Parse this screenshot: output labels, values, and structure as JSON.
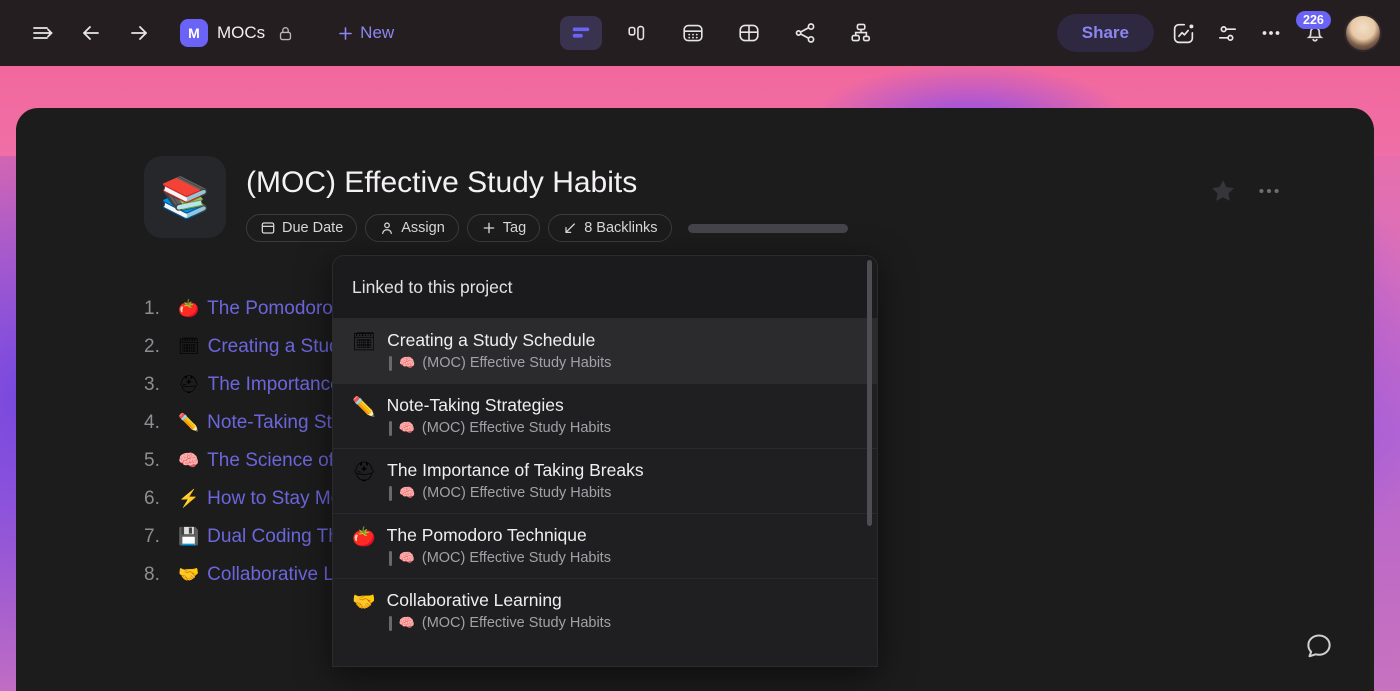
{
  "topbar": {
    "nav": {
      "sidebar_toggle": "sidebar-toggle-icon",
      "back": "back-arrow-icon",
      "forward": "forward-arrow-icon"
    },
    "workspace": {
      "initial": "M",
      "name": "MOCs",
      "lock_icon": "lock-icon"
    },
    "new_label": "New",
    "view_tabs": [
      {
        "name": "list-view",
        "icon": "list-view-icon",
        "active": true
      },
      {
        "name": "board-view",
        "icon": "board-view-icon",
        "active": false
      },
      {
        "name": "calendar-view",
        "icon": "calendar-view-icon",
        "active": false
      },
      {
        "name": "table-view",
        "icon": "table-view-icon",
        "active": false
      },
      {
        "name": "graph-view",
        "icon": "share-graph-icon",
        "active": false
      },
      {
        "name": "hierarchy-view",
        "icon": "hierarchy-icon",
        "active": false
      }
    ],
    "share_label": "Share",
    "activity_icon": "activity-chart-icon",
    "settings_icon": "sliders-icon",
    "more_icon": "ellipsis-icon",
    "notifications": {
      "icon": "bell-icon",
      "count": "226"
    },
    "avatar": "user-avatar"
  },
  "document": {
    "icon_emoji": "📚",
    "title": "(MOC) Effective Study Habits",
    "star_icon": "star-icon",
    "more_icon": "ellipsis-icon",
    "meta_pills": [
      {
        "icon": "calendar-icon",
        "label": "Due Date"
      },
      {
        "icon": "person-icon",
        "label": "Assign"
      },
      {
        "icon": "plus-icon",
        "label": "Tag"
      },
      {
        "icon": "backlink-arrow-icon",
        "label": "8 Backlinks"
      }
    ],
    "list": [
      {
        "num": "1.",
        "emoji": "🍅",
        "text": "The Pomodoro Technique"
      },
      {
        "num": "2.",
        "emoji": "🗓",
        "text": "Creating a Study Schedule"
      },
      {
        "num": "3.",
        "emoji": "⛑",
        "text": "The Importance of Taking Breaks"
      },
      {
        "num": "4.",
        "emoji": "✏️",
        "text": "Note-Taking Strategies"
      },
      {
        "num": "5.",
        "emoji": "🧠",
        "text": "The Science of Learning"
      },
      {
        "num": "6.",
        "emoji": "⚡",
        "text": "How to Stay Motivated"
      },
      {
        "num": "7.",
        "emoji": "💾",
        "text": "Dual Coding Theory"
      },
      {
        "num": "8.",
        "emoji": "🤝",
        "text": "Collaborative Learning"
      }
    ]
  },
  "popup": {
    "header": "Linked to this project",
    "items": [
      {
        "emoji": "🗓",
        "title": "Creating a Study Schedule",
        "sub_emoji": "🧠",
        "sub": "(MOC) Effective Study Habits",
        "selected": true
      },
      {
        "emoji": "✏️",
        "title": "Note-Taking Strategies",
        "sub_emoji": "🧠",
        "sub": "(MOC) Effective Study Habits",
        "selected": false
      },
      {
        "emoji": "⛑",
        "title": "The Importance of Taking Breaks",
        "sub_emoji": "🧠",
        "sub": "(MOC) Effective Study Habits",
        "selected": false
      },
      {
        "emoji": "🍅",
        "title": "The Pomodoro Technique",
        "sub_emoji": "🧠",
        "sub": "(MOC) Effective Study Habits",
        "selected": false
      },
      {
        "emoji": "🤝",
        "title": "Collaborative Learning",
        "sub_emoji": "🧠",
        "sub": "(MOC) Effective Study Habits",
        "selected": false
      }
    ]
  },
  "chat_icon": "comment-bubble-icon",
  "colors": {
    "accent_purple": "#6b63f5",
    "link_indigo": "#6c66dd",
    "topbar_bg": "#241e21",
    "card_bg": "#1c1c1c",
    "popup_bg": "#1f1f21"
  }
}
